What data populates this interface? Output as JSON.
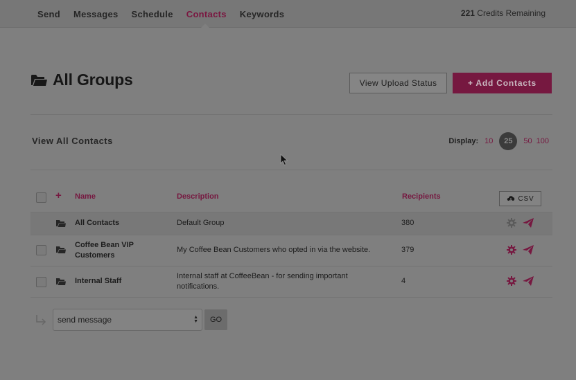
{
  "nav": {
    "items": [
      {
        "label": "Send"
      },
      {
        "label": "Messages"
      },
      {
        "label": "Schedule"
      },
      {
        "label": "Contacts",
        "active": true
      },
      {
        "label": "Keywords"
      }
    ],
    "credits_count": "221",
    "credits_text": " Credits Remaining"
  },
  "header": {
    "title": "All Groups",
    "upload_status_label": "View Upload Status",
    "add_contacts_label": "+ Add Contacts"
  },
  "section": {
    "title": "View All Contacts",
    "display_label": "Display:",
    "page_sizes": [
      "10",
      "25",
      "50",
      "100"
    ],
    "selected_page_size": "25"
  },
  "table": {
    "headers": {
      "name": "Name",
      "description": "Description",
      "recipients": "Recipients"
    },
    "csv_label": "CSV",
    "rows": [
      {
        "name_lines": [
          "All Contacts"
        ],
        "description_lines": [
          "Default Group"
        ],
        "recipients": "380",
        "has_checkbox": false,
        "gear_active": false
      },
      {
        "name_lines": [
          "Coffee Bean VIP",
          "Customers"
        ],
        "description_lines": [
          "My Coffee Bean Customers who opted in via the website."
        ],
        "recipients": "379",
        "has_checkbox": true,
        "gear_active": true
      },
      {
        "name_lines": [
          "Internal Staff"
        ],
        "description_lines": [
          "Internal staff at CoffeeBean - for sending important",
          "notifications."
        ],
        "recipients": "4",
        "has_checkbox": true,
        "gear_active": true
      }
    ]
  },
  "bulk_action": {
    "selected": "send message",
    "go_label": "GO"
  },
  "colors": {
    "accent": "#761840",
    "overlay_background": "#7f7f7f"
  }
}
